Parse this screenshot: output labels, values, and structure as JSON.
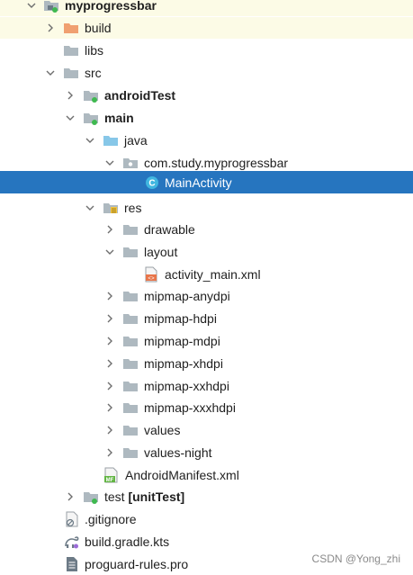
{
  "project_tree": {
    "root": {
      "label": "myprogressbar",
      "icon": "module-folder-icon"
    },
    "build": {
      "label": "build",
      "icon": "excluded-folder-icon"
    },
    "libs": {
      "label": "libs",
      "icon": "folder-icon"
    },
    "src": {
      "label": "src",
      "icon": "folder-icon"
    },
    "androidTest": {
      "label": "androidTest",
      "icon": "source-set-folder-icon"
    },
    "main": {
      "label": "main",
      "icon": "source-set-folder-icon"
    },
    "java": {
      "label": "java",
      "icon": "source-root-folder-icon"
    },
    "package": {
      "label": "com.study.myprogressbar",
      "icon": "package-icon"
    },
    "main_activity": {
      "label": "MainActivity",
      "icon": "kotlin-class-icon",
      "icon_letter": "C"
    },
    "res": {
      "label": "res",
      "icon": "resource-folder-icon"
    },
    "drawable": {
      "label": "drawable",
      "icon": "folder-icon"
    },
    "layout": {
      "label": "layout",
      "icon": "folder-icon"
    },
    "activity_main": {
      "label": "activity_main.xml",
      "icon": "xml-layout-file-icon"
    },
    "mipmap_anydpi": {
      "label": "mipmap-anydpi",
      "icon": "folder-icon"
    },
    "mipmap_hdpi": {
      "label": "mipmap-hdpi",
      "icon": "folder-icon"
    },
    "mipmap_mdpi": {
      "label": "mipmap-mdpi",
      "icon": "folder-icon"
    },
    "mipmap_xhdpi": {
      "label": "mipmap-xhdpi",
      "icon": "folder-icon"
    },
    "mipmap_xxhdpi": {
      "label": "mipmap-xxhdpi",
      "icon": "folder-icon"
    },
    "mipmap_xxxhdpi": {
      "label": "mipmap-xxxhdpi",
      "icon": "folder-icon"
    },
    "values": {
      "label": "values",
      "icon": "folder-icon"
    },
    "values_night": {
      "label": "values-night",
      "icon": "folder-icon"
    },
    "manifest": {
      "label": "AndroidManifest.xml",
      "icon": "manifest-file-icon",
      "icon_letters": "MF"
    },
    "test": {
      "label": "test",
      "suffix": "[unitTest]",
      "icon": "source-set-folder-icon"
    },
    "gitignore": {
      "label": ".gitignore",
      "icon": "gitignore-file-icon"
    },
    "gradle": {
      "label": "build.gradle.kts",
      "icon": "gradle-file-icon"
    },
    "proguard": {
      "label": "proguard-rules.pro",
      "icon": "text-file-icon"
    }
  },
  "watermark": "CSDN @Yong_zhi",
  "colors": {
    "selection": "#2675bf",
    "highlight_row": "#fcfbe6",
    "folder": "#aeb9c0",
    "excluded_folder": "#f0a070",
    "source_root": "#87c7e8",
    "module_badge": "#3fb950",
    "class_icon": "#40b6e0",
    "xml_icon": "#e8754a",
    "manifest_icon": "#62b543"
  }
}
